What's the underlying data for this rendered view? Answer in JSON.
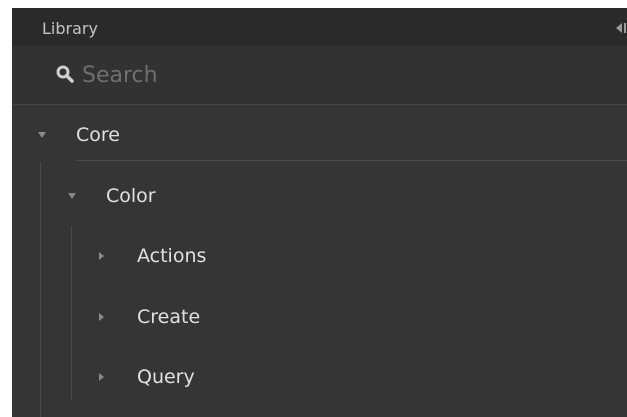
{
  "header": {
    "title": "Library",
    "collapse_icon": "collapse-panel-icon"
  },
  "search": {
    "placeholder": "Search",
    "value": "",
    "icon": "search-icon"
  },
  "tree": {
    "core": {
      "label": "Core",
      "expanded": true
    },
    "color": {
      "label": "Color",
      "expanded": true
    },
    "items": [
      {
        "label": "Actions",
        "expanded": false
      },
      {
        "label": "Create",
        "expanded": false
      },
      {
        "label": "Query",
        "expanded": false
      }
    ]
  },
  "colors": {
    "panel_background": "#353535",
    "header_background": "#2a2a2a",
    "text": "#e0e0e0",
    "muted_text": "#6f6f6f",
    "caret": "#8a8a8a"
  }
}
